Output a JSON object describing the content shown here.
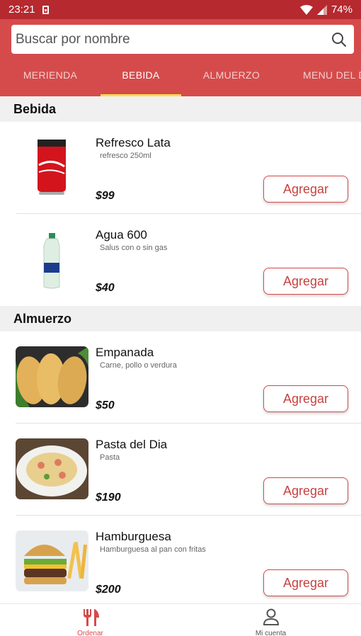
{
  "status_bar": {
    "time": "23:21",
    "battery": "74%"
  },
  "search": {
    "placeholder": "Buscar por nombre"
  },
  "tabs": [
    {
      "label": "MERIENDA"
    },
    {
      "label": "BEBIDA"
    },
    {
      "label": "ALMUERZO"
    },
    {
      "label": "MENU DEL D"
    }
  ],
  "sections": [
    {
      "title": "Bebida",
      "items": [
        {
          "name": "Refresco Lata",
          "desc": "refresco 250ml",
          "price": "$99",
          "button": "Agregar",
          "image": "coca-cola-can"
        },
        {
          "name": "Agua 600",
          "desc": "Salus con o sin gas",
          "price": "$40",
          "button": "Agregar",
          "image": "water-bottle"
        }
      ]
    },
    {
      "title": "Almuerzo",
      "items": [
        {
          "name": "Empanada",
          "desc": "Carne, pollo o verdura",
          "price": "$50",
          "button": "Agregar",
          "image": "empanadas"
        },
        {
          "name": "Pasta del Dia",
          "desc": "Pasta",
          "price": "$190",
          "button": "Agregar",
          "image": "pasta-dish"
        },
        {
          "name": "Hamburguesa",
          "desc": "Hamburguesa al pan con fritas",
          "price": "$200",
          "button": "Agregar",
          "image": "burger-fries"
        }
      ]
    }
  ],
  "bottom_nav": {
    "ordenar": "Ordenar",
    "cuenta": "Mi cuenta"
  },
  "colors": {
    "primary": "#d54b4b",
    "status_bar": "#b5292f",
    "tab_indicator": "#f7d94c"
  }
}
